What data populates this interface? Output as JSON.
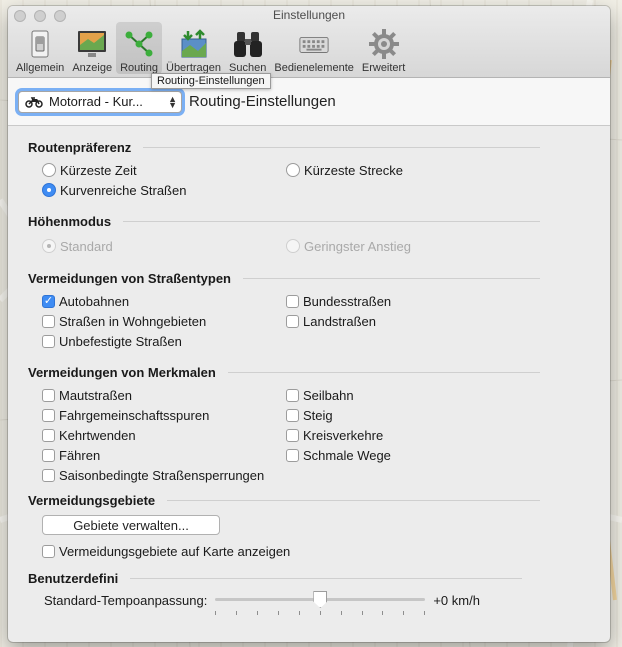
{
  "window": {
    "title": "Einstellungen"
  },
  "toolbar": [
    {
      "label": "Allgemein",
      "icon": "switch-icon"
    },
    {
      "label": "Anzeige",
      "icon": "display-icon"
    },
    {
      "label": "Routing",
      "icon": "routing-icon",
      "active": true
    },
    {
      "label": "Übertragen",
      "icon": "transfer-icon"
    },
    {
      "label": "Suchen",
      "icon": "binoculars-icon"
    },
    {
      "label": "Bedienelemente",
      "icon": "keyboard-icon"
    },
    {
      "label": "Erweitert",
      "icon": "gear-icon"
    }
  ],
  "tooltip": "Routing-Einstellungen",
  "header": {
    "profile_value": "Motorrad - Kur...",
    "title": "Routing-Einstellungen"
  },
  "routenpraeferenz": {
    "title": "Routenpräferenz",
    "options": [
      "Kürzeste Zeit",
      "Kürzeste Strecke",
      "Kurvenreiche Straßen"
    ],
    "selected": "Kurvenreiche Straßen"
  },
  "hoehenmodus": {
    "title": "Höhenmodus",
    "options": [
      "Standard",
      "Geringster Anstieg"
    ],
    "selected": "Standard"
  },
  "strassentypen": {
    "title": "Vermeidungen von Straßentypen",
    "items": [
      {
        "label": "Autobahnen",
        "checked": true
      },
      {
        "label": "Bundesstraßen",
        "checked": false
      },
      {
        "label": "Straßen in Wohngebieten",
        "checked": false
      },
      {
        "label": "Landstraßen",
        "checked": false
      },
      {
        "label": "Unbefestigte Straßen",
        "checked": false
      }
    ]
  },
  "merkmale": {
    "title": "Vermeidungen von Merkmalen",
    "items": [
      {
        "label": "Mautstraßen",
        "checked": false
      },
      {
        "label": "Seilbahn",
        "checked": false
      },
      {
        "label": "Fahrgemeinschaftsspuren",
        "checked": false
      },
      {
        "label": "Steig",
        "checked": false
      },
      {
        "label": "Kehrtwenden",
        "checked": false
      },
      {
        "label": "Kreisverkehre",
        "checked": false
      },
      {
        "label": "Fähren",
        "checked": false
      },
      {
        "label": "Schmale Wege",
        "checked": false
      },
      {
        "label": "Saisonbedingte Straßensperrungen",
        "checked": false
      }
    ]
  },
  "gebiete": {
    "title": "Vermeidungsgebiete",
    "button": "Gebiete verwalten...",
    "show_on_map": {
      "label": "Vermeidungsgebiete auf Karte anzeigen",
      "checked": false
    }
  },
  "benutzer": {
    "title": "Benutzerdefini",
    "tempo_label": "Standard-Tempoanpassung:",
    "tempo_value": "+0 km/h",
    "slider_fraction": 0.5
  },
  "colors": {
    "accent": "#3f8cf3",
    "focus_ring": "#7bb0f4"
  }
}
